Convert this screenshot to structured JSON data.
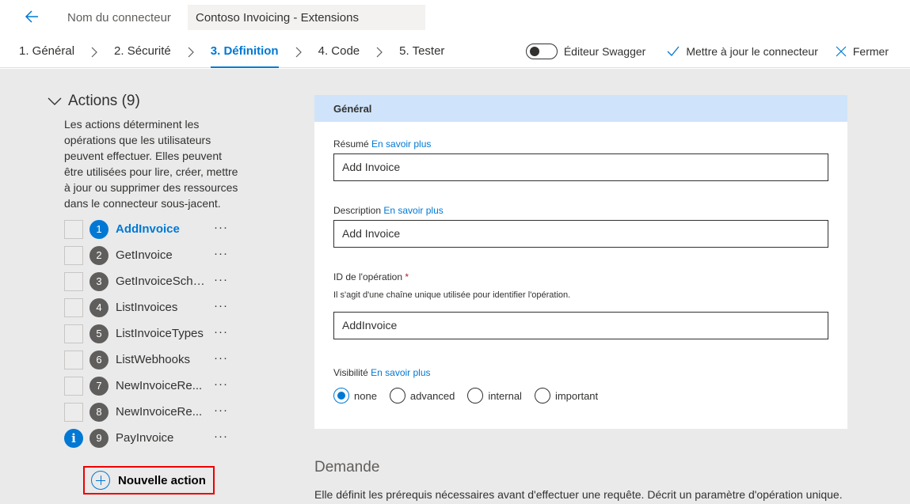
{
  "header": {
    "connector_label": "Nom du connecteur",
    "connector_name": "Contoso Invoicing - Extensions"
  },
  "steps": [
    {
      "label": "1. Général"
    },
    {
      "label": "2. Sécurité"
    },
    {
      "label": "3. Définition"
    },
    {
      "label": "4. Code"
    },
    {
      "label": "5. Tester"
    }
  ],
  "toolbar": {
    "swagger_label": "Éditeur Swagger",
    "update_label": "Mettre à jour le connecteur",
    "close_label": "Fermer"
  },
  "actions": {
    "title": "Actions (9)",
    "description": "Les actions déterminent les opérations que les utilisateurs peuvent effectuer. Elles peuvent être utilisées pour lire, créer, mettre à jour ou supprimer des ressources dans le connecteur sous-jacent.",
    "items": [
      {
        "num": "1",
        "name": "AddInvoice"
      },
      {
        "num": "2",
        "name": "GetInvoice"
      },
      {
        "num": "3",
        "name": "GetInvoiceSche..."
      },
      {
        "num": "4",
        "name": "ListInvoices"
      },
      {
        "num": "5",
        "name": "ListInvoiceTypes"
      },
      {
        "num": "6",
        "name": "ListWebhooks"
      },
      {
        "num": "7",
        "name": "NewInvoiceRe..."
      },
      {
        "num": "8",
        "name": "NewInvoiceRe..."
      },
      {
        "num": "9",
        "name": "PayInvoice"
      }
    ],
    "more": "···",
    "info_glyph": "i",
    "new_action_label": "Nouvelle action"
  },
  "general": {
    "title": "Général",
    "learn_more": "En savoir plus",
    "summary_label": "Résumé",
    "summary_value": "Add Invoice",
    "description_label": "Description",
    "description_value": "Add Invoice",
    "operation_id_label": "ID de l'opération",
    "required_mark": "*",
    "operation_id_hint": "Il s'agit d'une chaîne unique utilisée pour identifier l'opération.",
    "operation_id_value": "AddInvoice",
    "visibility_label": "Visibilité",
    "visibility_options": [
      "none",
      "advanced",
      "internal",
      "important"
    ],
    "visibility_selected": "none"
  },
  "demande": {
    "title": "Demande",
    "description": "Elle définit les prérequis nécessaires avant d'effectuer une requête. Décrit un paramètre d'opération unique."
  },
  "colors": {
    "accent": "#0078d4",
    "highlight_box": "#e00000",
    "section_header": "#cfe4fa",
    "background": "#eaeaea"
  }
}
